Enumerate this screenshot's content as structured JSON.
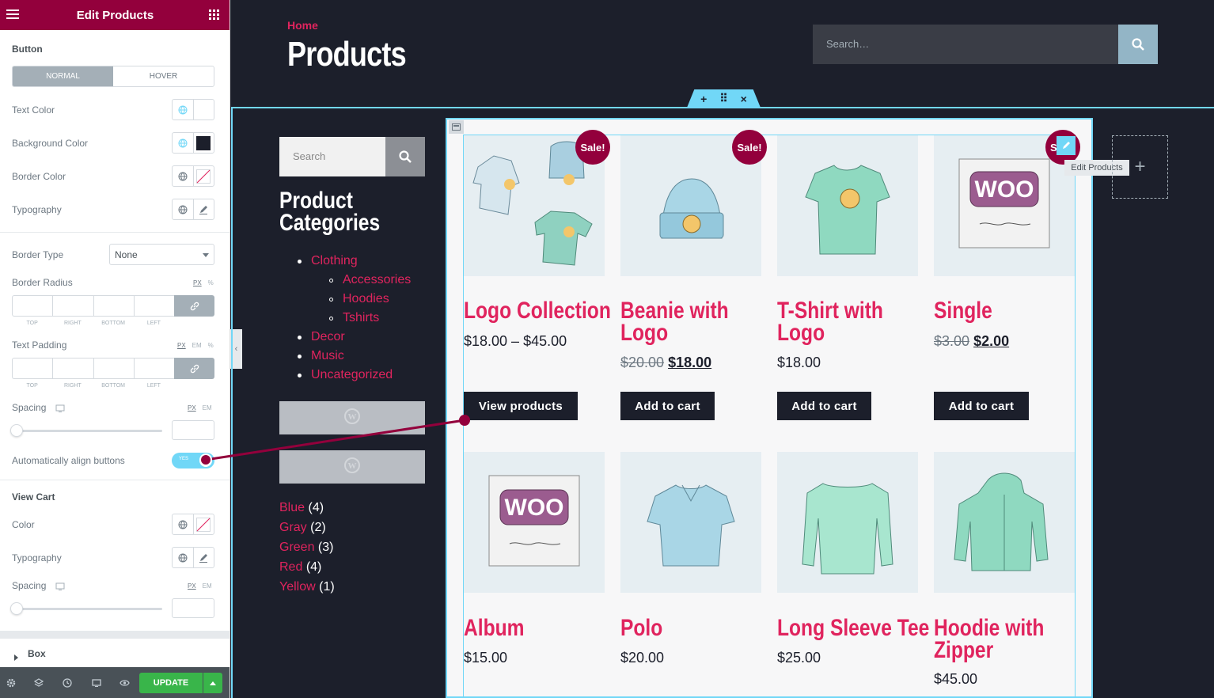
{
  "panel": {
    "title": "Edit Products",
    "button_section": {
      "title": "Button",
      "tabs": [
        "NORMAL",
        "HOVER"
      ],
      "text_color_label": "Text Color",
      "bg_color_label": "Background Color",
      "border_color_label": "Border Color",
      "typography_label": "Typography",
      "border_type_label": "Border Type",
      "border_type_value": "None",
      "border_radius_label": "Border Radius",
      "border_radius_units": [
        "PX",
        "%"
      ],
      "dim_labels": [
        "TOP",
        "RIGHT",
        "BOTTOM",
        "LEFT"
      ],
      "text_padding_label": "Text Padding",
      "text_padding_units": [
        "PX",
        "EM",
        "%"
      ],
      "spacing_label": "Spacing",
      "spacing_units": [
        "PX",
        "EM"
      ],
      "auto_align_label": "Automatically align buttons",
      "auto_align_value": "YES"
    },
    "view_cart_section": {
      "title": "View Cart",
      "color_label": "Color",
      "typography_label": "Typography",
      "spacing_label": "Spacing",
      "spacing_units": [
        "PX",
        "EM"
      ]
    },
    "box_section": {
      "title": "Box"
    },
    "footer": {
      "update_label": "UPDATE"
    },
    "colors": {
      "accent": "#93003c",
      "update": "#39b54a",
      "bg_swatch": "#1c1f2b"
    }
  },
  "page": {
    "breadcrumb": "Home",
    "title": "Products",
    "search_placeholder": "Search…"
  },
  "editor": {
    "tooltip": "Edit Products",
    "handle": [
      "+",
      "⠿",
      "×"
    ]
  },
  "sidebar": {
    "search_placeholder": "Search",
    "categories_title_1": "Product",
    "categories_title_2": "Categories",
    "categories": [
      {
        "label": "Clothing",
        "level": 0
      },
      {
        "label": "Accessories",
        "level": 1
      },
      {
        "label": "Hoodies",
        "level": 1
      },
      {
        "label": "Tshirts",
        "level": 1
      },
      {
        "label": "Decor",
        "level": 0
      },
      {
        "label": "Music",
        "level": 0
      },
      {
        "label": "Uncategorized",
        "level": 0
      }
    ],
    "attributes": [
      {
        "name": "Blue",
        "count": "(4)"
      },
      {
        "name": "Gray",
        "count": "(2)"
      },
      {
        "name": "Green",
        "count": "(3)"
      },
      {
        "name": "Red",
        "count": "(4)"
      },
      {
        "name": "Yellow",
        "count": "(1)"
      }
    ]
  },
  "products": [
    {
      "name": "Logo Collection",
      "price": "$18.00 – $45.00",
      "old_price": "",
      "sale": "Sale!",
      "button": "View products",
      "image": "clothing-collection"
    },
    {
      "name": "Beanie with Logo",
      "price": "$18.00",
      "old_price": "$20.00",
      "sale": "Sale!",
      "button": "Add to cart",
      "image": "beanie"
    },
    {
      "name": "T-Shirt with Logo",
      "price": "$18.00",
      "old_price": "",
      "sale": "",
      "button": "Add to cart",
      "image": "tshirt"
    },
    {
      "name": "Single",
      "price": "$2.00",
      "old_price": "$3.00",
      "sale": "S",
      "button": "Add to cart",
      "image": "woo-single"
    },
    {
      "name": "Album",
      "price": "$15.00",
      "old_price": "",
      "sale": "",
      "button": "",
      "image": "woo-album"
    },
    {
      "name": "Polo",
      "price": "$20.00",
      "old_price": "",
      "sale": "",
      "button": "",
      "image": "polo"
    },
    {
      "name": "Long Sleeve Tee",
      "price": "$25.00",
      "old_price": "",
      "sale": "",
      "button": "",
      "image": "long-sleeve"
    },
    {
      "name": "Hoodie with Zipper",
      "price": "$45.00",
      "old_price": "",
      "sale": "",
      "button": "",
      "image": "hoodie-zipper"
    }
  ]
}
